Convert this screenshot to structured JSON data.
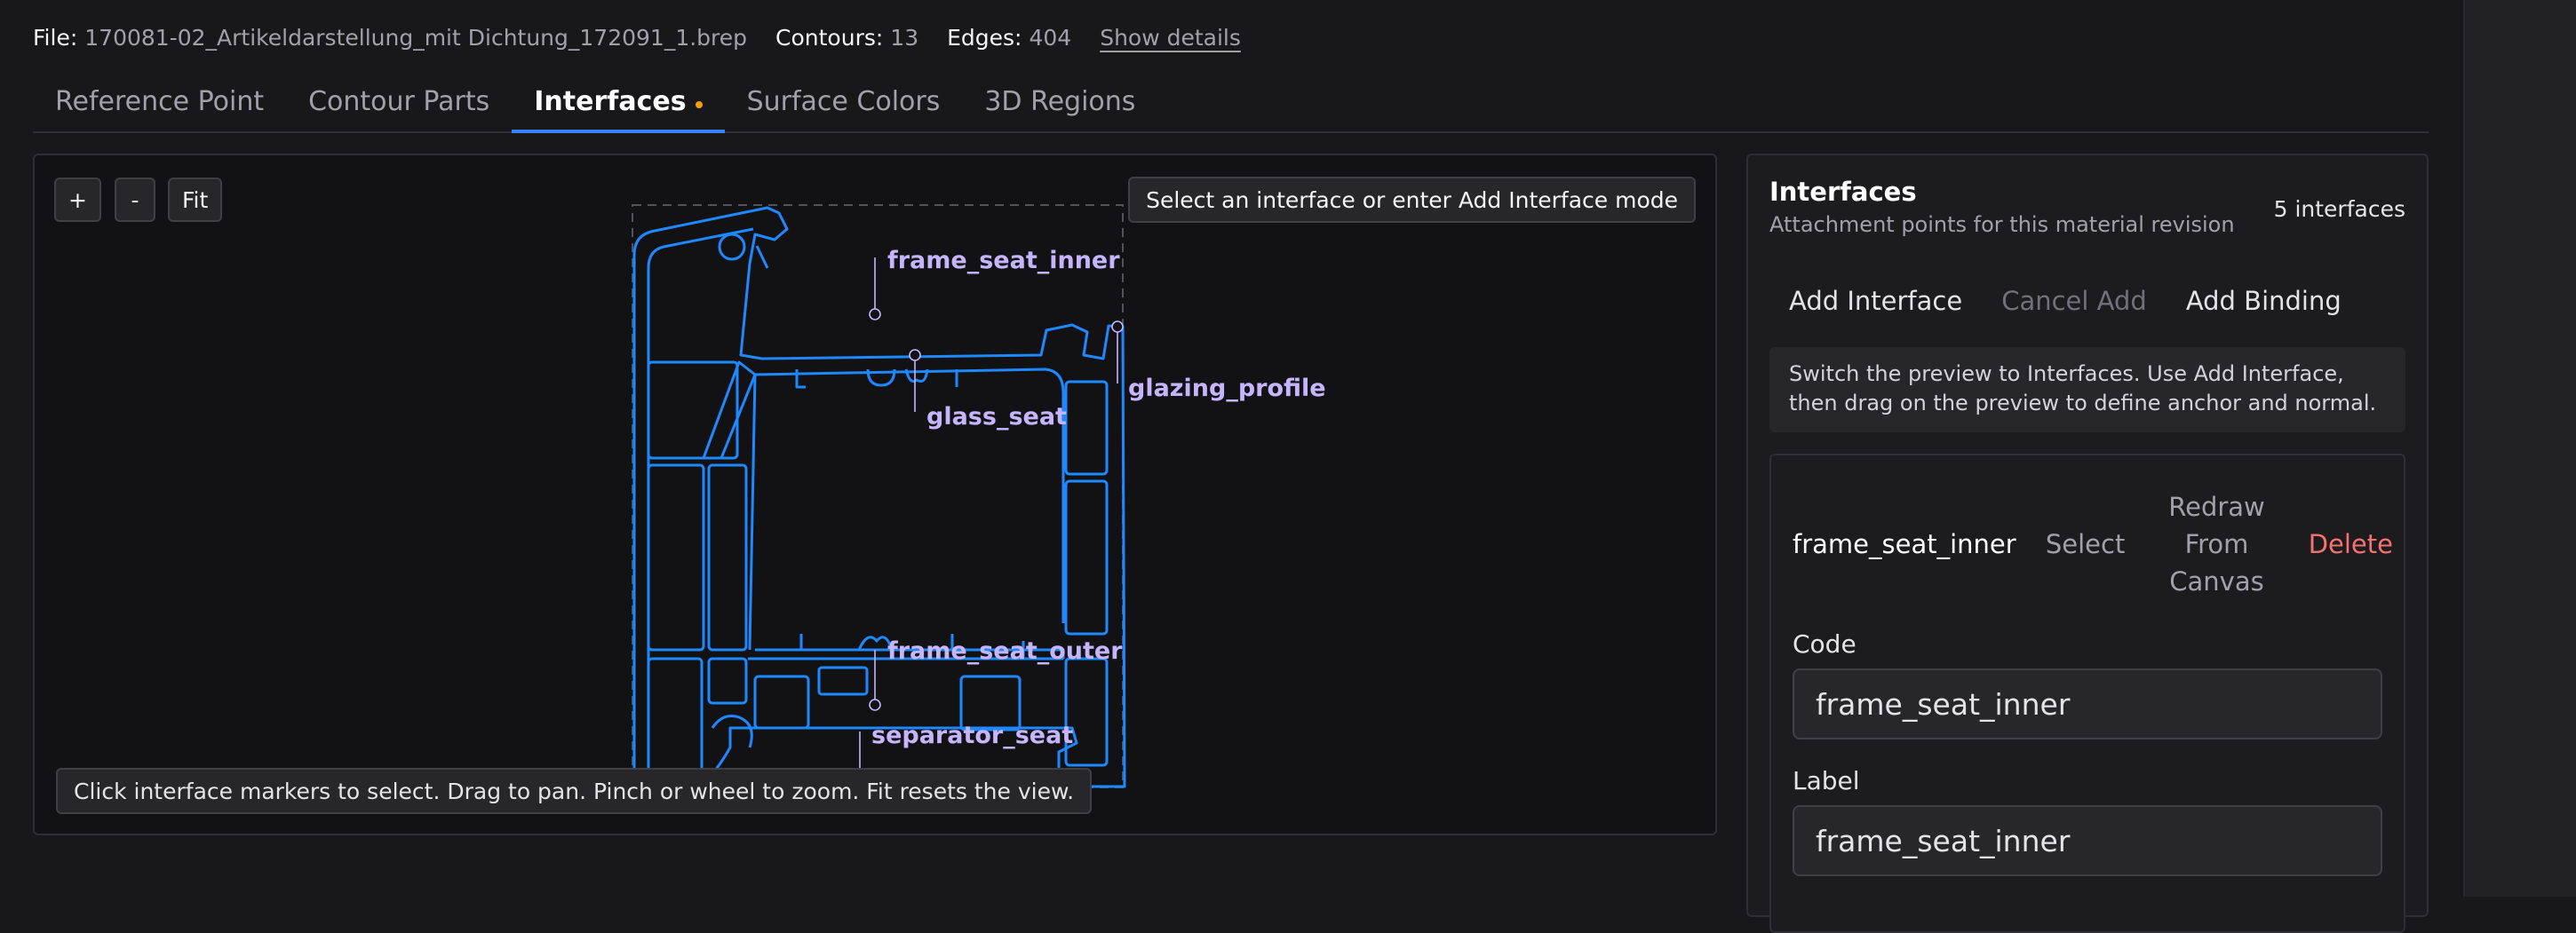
{
  "file_bar": {
    "file_label": "File:",
    "file_name": "170081-02_Artikeldarstellung_mit Dichtung_172091_1.brep",
    "contours_label": "Contours:",
    "contours_value": "13",
    "edges_label": "Edges:",
    "edges_value": "404",
    "show_details": "Show details"
  },
  "tabs": [
    {
      "label": "Reference Point"
    },
    {
      "label": "Contour Parts"
    },
    {
      "label": "Interfaces"
    },
    {
      "label": "Surface Colors"
    },
    {
      "label": "3D Regions"
    }
  ],
  "active_tab_index": 2,
  "canvas": {
    "zoom_in": "+",
    "zoom_out": "-",
    "fit": "Fit",
    "top_hint": "Select an interface or enter Add Interface mode",
    "bottom_hint": "Click interface markers to select. Drag to pan. Pinch or wheel to zoom. Fit resets the view.",
    "profile_color": "#1e88ff",
    "marker_color": "#c4b5fd",
    "interface_labels": {
      "frame_seat_inner": "frame_seat_inner",
      "glass_seat": "glass_seat",
      "glazing_profile": "glazing_profile",
      "frame_seat_outer": "frame_seat_outer",
      "separator_seat": "separator_seat"
    }
  },
  "panel": {
    "title": "Interfaces",
    "subtitle": "Attachment points for this material revision",
    "count": "5 interfaces",
    "actions": {
      "add_interface": "Add Interface",
      "cancel_add": "Cancel Add",
      "add_binding": "Add Binding"
    },
    "info": "Switch the preview to Interfaces. Use Add Interface, then drag on the preview to define anchor and normal.",
    "card": {
      "code": "frame_seat_inner",
      "select": "Select",
      "redraw": "Redraw From Canvas",
      "delete": "Delete",
      "code_label": "Code",
      "code_value": "frame_seat_inner",
      "label_label": "Label",
      "label_value": "frame_seat_inner"
    }
  }
}
